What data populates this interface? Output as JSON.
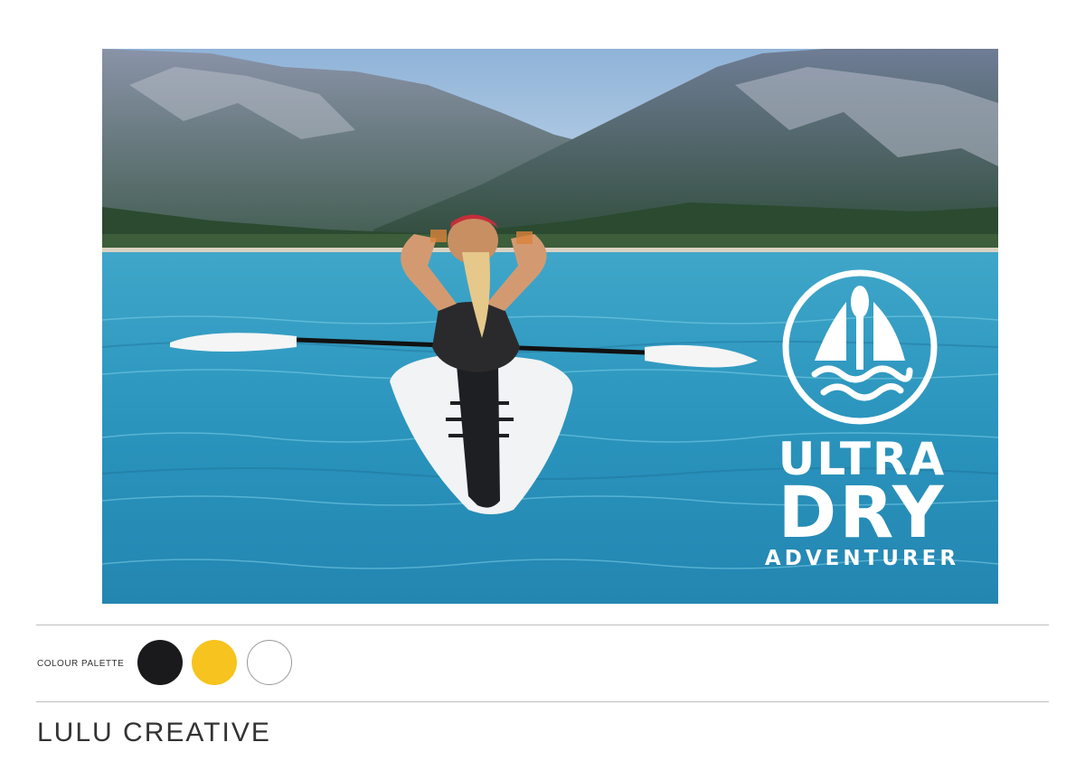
{
  "brand": {
    "line1": "ULTRA",
    "line2": "DRY",
    "line3": "ADVENTURER"
  },
  "palette": {
    "label": "COLOUR PALETTE",
    "colors": [
      "#1a1a1c",
      "#f7c31f",
      "#ffffff"
    ]
  },
  "footer": {
    "studio": "LULU CREATIVE"
  }
}
